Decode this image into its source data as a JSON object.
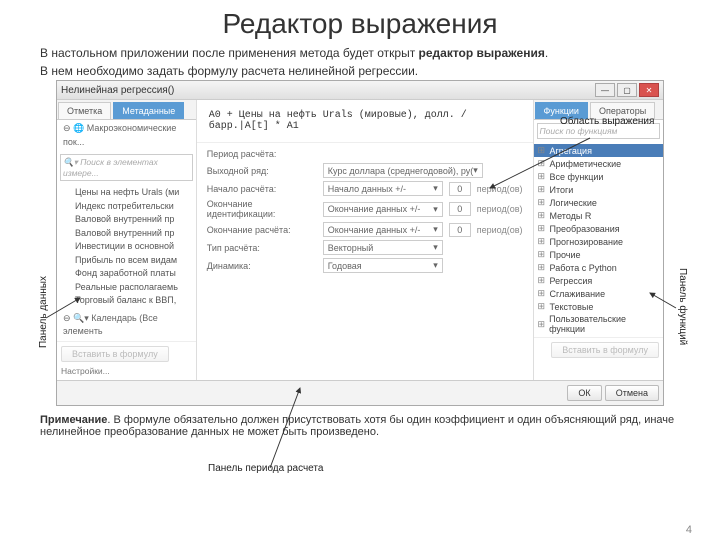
{
  "slide": {
    "title": "Редактор выражения",
    "intro1a": "В настольном приложении после применения метода будет открыт ",
    "intro1b": "редактор выражения",
    "intro1c": ".",
    "intro2": "В нем необходимо задать формулу расчета нелинейной регрессии.",
    "note_b": "Примечание",
    "note": ". В формуле обязательно должен присутствовать хотя бы один коэффициент и один объясняющий ряд, иначе нелинейное преобразование данных не может быть произведено.",
    "pagenum": "4"
  },
  "labels": {
    "data_panel": "Панель данных",
    "func_panel": "Панель функций",
    "expr_area": "Область выражения",
    "calc_panel": "Панель периода расчета"
  },
  "window": {
    "title": "Нелинейная регрессия()"
  },
  "left": {
    "tab1": "Отметка",
    "tab2": "Метаданные",
    "root1": "Макроэкономические пок...",
    "search": "Поиск в элементах измере...",
    "items": [
      "Цены на нефть Urals (ми",
      "Индекс потребительски",
      "Валовой внутренний пр",
      "Валовой внутренний пр",
      "Инвестиции в основной",
      "Прибыль по всем видам",
      "Фонд заработной платы",
      "Реальные располагаемь",
      "Торговый баланс к ВВП,"
    ],
    "root2": "Календарь (Все элементь",
    "insert": "Вставить в формулу",
    "settings": "Настройки..."
  },
  "center": {
    "formula": "A0 + Цены на нефть Urals (мировые), долл. / барр.|A[t] * A1",
    "ptitle": "Период расчёта:",
    "rows": [
      {
        "label": "Выходной ряд:",
        "val": "Курс доллара (среднегодовой), ру(",
        "num": "",
        "unit": ""
      },
      {
        "label": "Начало расчёта:",
        "val": "Начало данных +/-",
        "num": "0",
        "unit": "период(ов)"
      },
      {
        "label": "Окончание идентификации:",
        "val": "Окончание данных +/-",
        "num": "0",
        "unit": "период(ов)"
      },
      {
        "label": "Окончание расчёта:",
        "val": "Окончание данных +/-",
        "num": "0",
        "unit": "период(ов)"
      },
      {
        "label": "Тип расчёта:",
        "val": "Векторный",
        "num": "",
        "unit": ""
      },
      {
        "label": "Динамика:",
        "val": "Годовая",
        "num": "",
        "unit": ""
      }
    ]
  },
  "right": {
    "tab1": "Функции",
    "tab2": "Операторы",
    "search": "Поиск по функциям",
    "cats": [
      "Агрегация",
      "Арифметические",
      "Все функции",
      "Итоги",
      "Логические",
      "Методы R",
      "Преобразования",
      "Прогнозирование",
      "Прочие",
      "Работа с Python",
      "Регрессия",
      "Сглаживание",
      "Текстовые",
      "Пользовательские функции"
    ],
    "insert": "Вставить в формулу"
  },
  "footer": {
    "ok": "ОК",
    "cancel": "Отмена"
  }
}
